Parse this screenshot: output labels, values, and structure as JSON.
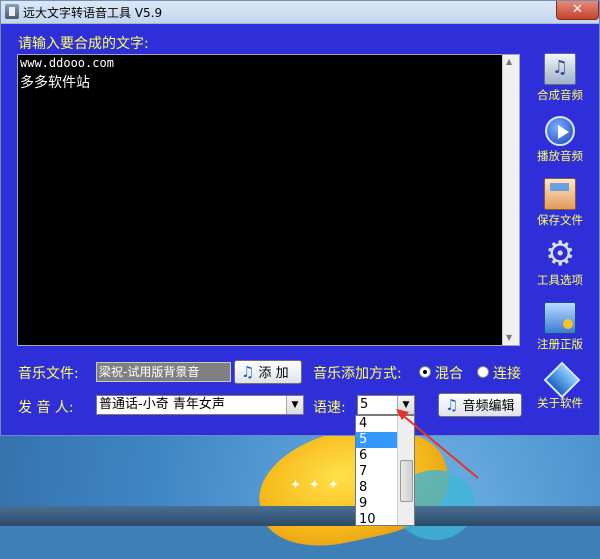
{
  "window": {
    "title": "远大文字转语音工具 V5.9",
    "close_label": "✕"
  },
  "editor": {
    "label": "请输入要合成的文字:",
    "line1": "www.ddooo.com",
    "line2": "多多软件站"
  },
  "tools": [
    {
      "label": "合成音频",
      "icon": "audio-file-icon"
    },
    {
      "label": "播放音频",
      "icon": "play-icon"
    },
    {
      "label": "保存文件",
      "icon": "save-icon"
    },
    {
      "label": "工具选项",
      "icon": "gear-icon"
    },
    {
      "label": "注册正版",
      "icon": "register-icon"
    },
    {
      "label": "关于软件",
      "icon": "info-icon"
    }
  ],
  "music": {
    "label": "音乐文件:",
    "value": "梁祝-试用版背景音",
    "add_label": "添 加",
    "mode_label": "音乐添加方式:",
    "mode_mix": "混合",
    "mode_concat": "连接",
    "mode_selected": "混合"
  },
  "voice": {
    "label": "发 音 人:",
    "value": "普通话-小奇 青年女声",
    "speed_label": "语速:",
    "speed_value": "5",
    "edit_label": "音频编辑"
  },
  "speed_options": [
    "4",
    "5",
    "6",
    "7",
    "8",
    "9",
    "10"
  ],
  "speed_selected": "5"
}
